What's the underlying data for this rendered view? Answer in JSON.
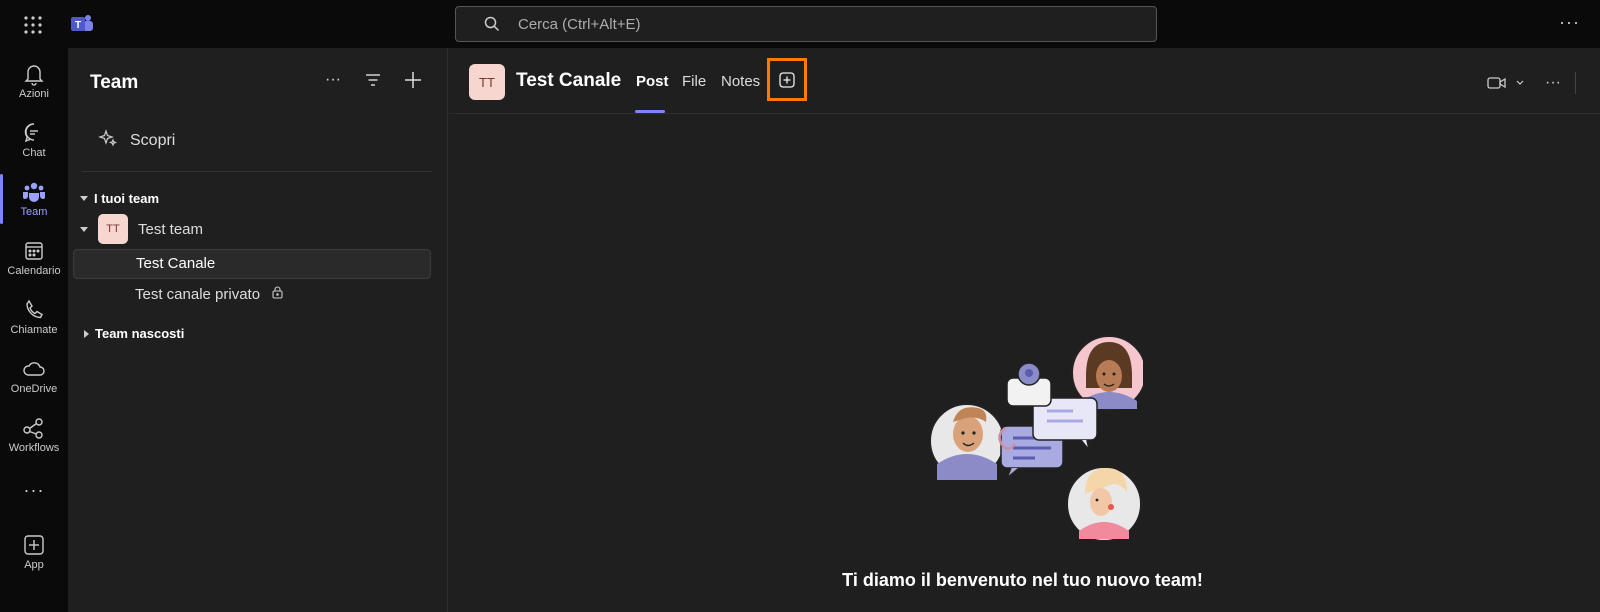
{
  "search": {
    "placeholder": "Cerca (Ctrl+Alt+E)"
  },
  "rail": {
    "items": [
      {
        "label": "Azioni",
        "icon": "bell-icon"
      },
      {
        "label": "Chat",
        "icon": "chat-icon"
      },
      {
        "label": "Team",
        "icon": "team-icon",
        "active": true
      },
      {
        "label": "Calendario",
        "icon": "calendar-icon"
      },
      {
        "label": "Chiamate",
        "icon": "phone-icon"
      },
      {
        "label": "OneDrive",
        "icon": "cloud-icon"
      },
      {
        "label": "Workflows",
        "icon": "workflows-icon"
      },
      {
        "label": "App",
        "icon": "add-app-icon"
      }
    ]
  },
  "panel": {
    "title": "Team",
    "discover": "Scopri",
    "your_teams": "I tuoi team",
    "team": {
      "avatar": "TT",
      "name": "Test team"
    },
    "channels": [
      {
        "name": "Test Canale",
        "active": true
      },
      {
        "name": "Test canale privato",
        "private": true
      }
    ],
    "hidden_teams": "Team nascosti"
  },
  "main": {
    "avatar": "TT",
    "title": "Test Canale",
    "tabs": [
      "Post",
      "File",
      "Notes"
    ],
    "welcome": "Ti diamo il benvenuto nel tuo nuovo team!"
  },
  "colors": {
    "accent": "#7f85f5",
    "highlight": "#ff7a00",
    "avatar_bg": "#f7d6d0"
  }
}
